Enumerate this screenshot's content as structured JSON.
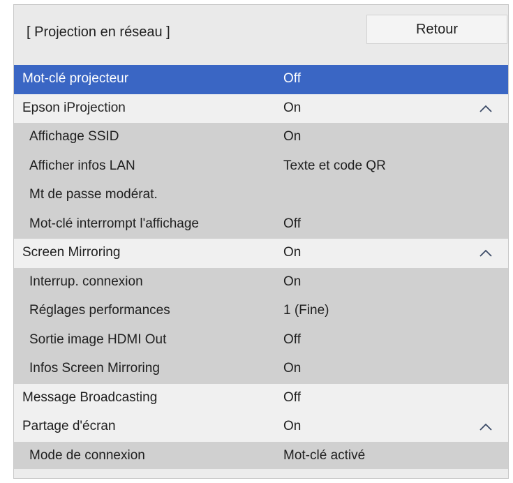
{
  "header": {
    "title": "[ Projection en réseau ]",
    "back_label": "Retour"
  },
  "rows": [
    {
      "label": "Mot-clé projecteur",
      "value": "Off",
      "level": "top",
      "selected": true,
      "chevron": false
    },
    {
      "label": "Epson iProjection",
      "value": "On",
      "level": "top",
      "selected": false,
      "chevron": true
    },
    {
      "label": "Affichage SSID",
      "value": "On",
      "level": "sub",
      "selected": false,
      "chevron": false
    },
    {
      "label": "Afficher infos LAN",
      "value": "Texte et code QR",
      "level": "sub",
      "selected": false,
      "chevron": false
    },
    {
      "label": "Mt de passe modérat.",
      "value": "",
      "level": "sub",
      "selected": false,
      "chevron": false
    },
    {
      "label": "Mot-clé interrompt l'affichage",
      "value": "Off",
      "level": "sub",
      "selected": false,
      "chevron": false
    },
    {
      "label": "Screen Mirroring",
      "value": "On",
      "level": "top",
      "selected": false,
      "chevron": true
    },
    {
      "label": "Interrup. connexion",
      "value": "On",
      "level": "sub",
      "selected": false,
      "chevron": false
    },
    {
      "label": "Réglages performances",
      "value": "1 (Fine)",
      "level": "sub",
      "selected": false,
      "chevron": false
    },
    {
      "label": "Sortie image HDMI Out",
      "value": "Off",
      "level": "sub",
      "selected": false,
      "chevron": false
    },
    {
      "label": "Infos Screen Mirroring",
      "value": "On",
      "level": "sub",
      "selected": false,
      "chevron": false
    },
    {
      "label": "Message Broadcasting",
      "value": "Off",
      "level": "top",
      "selected": false,
      "chevron": false
    },
    {
      "label": "Partage d'écran",
      "value": "On",
      "level": "top",
      "selected": false,
      "chevron": true
    },
    {
      "label": "Mode de connexion",
      "value": "Mot-clé activé",
      "level": "sub",
      "selected": false,
      "chevron": false
    }
  ],
  "colors": {
    "selected": "#3a66c4",
    "panel_bg": "#eaeaea",
    "sub_row_bg": "#d0d0d0",
    "top_row_bg": "#f0f0f0"
  }
}
